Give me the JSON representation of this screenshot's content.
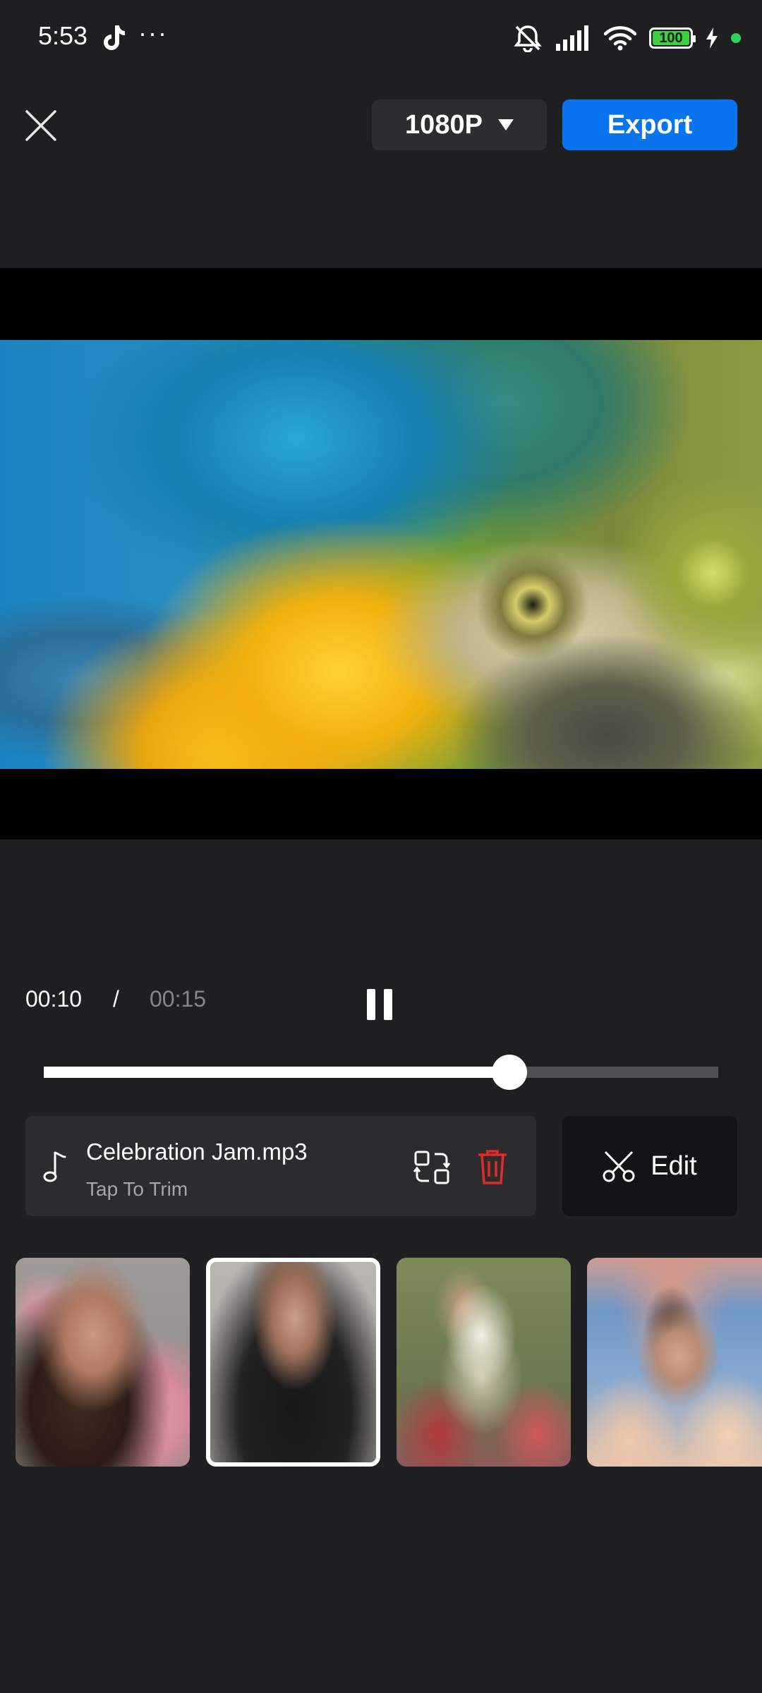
{
  "status_bar": {
    "time": "5:53",
    "dots": "···",
    "battery": "100",
    "icons": [
      "tiktok-icon",
      "mute-icon",
      "signal-icon",
      "wifi-icon",
      "battery-icon",
      "charging-icon",
      "green-dot"
    ]
  },
  "top_bar": {
    "close_icon": "close-icon",
    "resolution": "1080P",
    "export_label": "Export",
    "accent_color": "#0a73ee"
  },
  "preview": {
    "description_icon": "video-preview"
  },
  "playback": {
    "current_time": "00:10",
    "separator": "/",
    "total_time": "00:15",
    "progress": 0.69
  },
  "audio": {
    "track_name": "Celebration Jam.mp3",
    "subtitle": "Tap To Trim",
    "icons": [
      "music-note-icon",
      "replace-icon",
      "trash-icon"
    ],
    "delete_color": "#e02b2b"
  },
  "edit": {
    "label": "Edit",
    "icon": "scissors-icon"
  },
  "clips": {
    "selected_index": 1,
    "count": 4
  }
}
